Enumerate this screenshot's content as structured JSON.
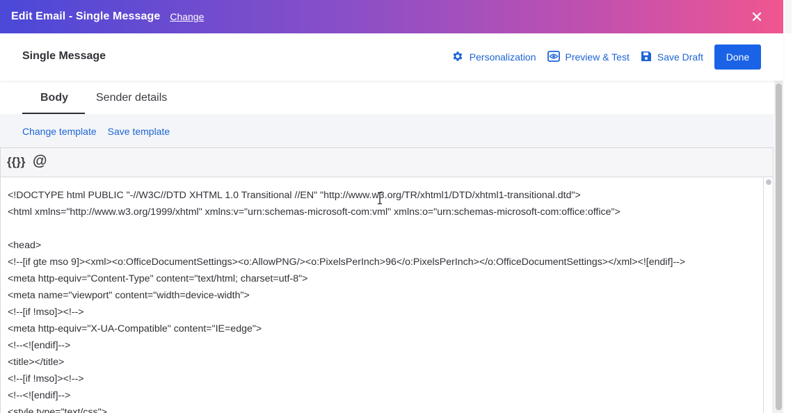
{
  "titlebar": {
    "title": "Edit Email - Single Message",
    "change_label": "Change",
    "close_icon": "close-icon",
    "gradient": [
      "#4b48d8",
      "#8b4fc7",
      "#c050b0",
      "#f0568f"
    ]
  },
  "header": {
    "title": "Single Message",
    "actions": [
      {
        "label": "Personalization",
        "icon": "gear-icon"
      },
      {
        "label": "Preview & Test",
        "icon": "eye-icon"
      },
      {
        "label": "Save Draft",
        "icon": "floppy-disk-icon"
      }
    ],
    "done_label": "Done",
    "accent": "#1a63e6"
  },
  "tabs": [
    {
      "label": "Body",
      "active": true
    },
    {
      "label": "Sender details",
      "active": false
    }
  ],
  "template_links": {
    "change": "Change template",
    "save": "Save template"
  },
  "toolbar": {
    "merge_tag_label": "{{}}",
    "mention_label": "@"
  },
  "code_lines": [
    "<!DOCTYPE html PUBLIC \"-//W3C//DTD XHTML 1.0 Transitional //EN\" \"http://www.w3.org/TR/xhtml1/DTD/xhtml1-transitional.dtd\">",
    "<html xmlns=\"http://www.w3.org/1999/xhtml\" xmlns:v=\"urn:schemas-microsoft-com:vml\" xmlns:o=\"urn:schemas-microsoft-com:office:office\">",
    "",
    "<head>",
    "<!--[if gte mso 9]><xml><o:OfficeDocumentSettings><o:AllowPNG/><o:PixelsPerInch>96</o:PixelsPerInch></o:OfficeDocumentSettings></xml><![endif]-->",
    "<meta http-equiv=\"Content-Type\" content=\"text/html; charset=utf-8\">",
    "<meta name=\"viewport\" content=\"width=device-width\">",
    "<!--[if !mso]><!-->",
    "<meta http-equiv=\"X-UA-Compatible\" content=\"IE=edge\">",
    "<!--<![endif]-->",
    "<title></title>",
    "<!--[if !mso]><!-->",
    "<!--<![endif]-->",
    "<style type=\"text/css\">"
  ]
}
